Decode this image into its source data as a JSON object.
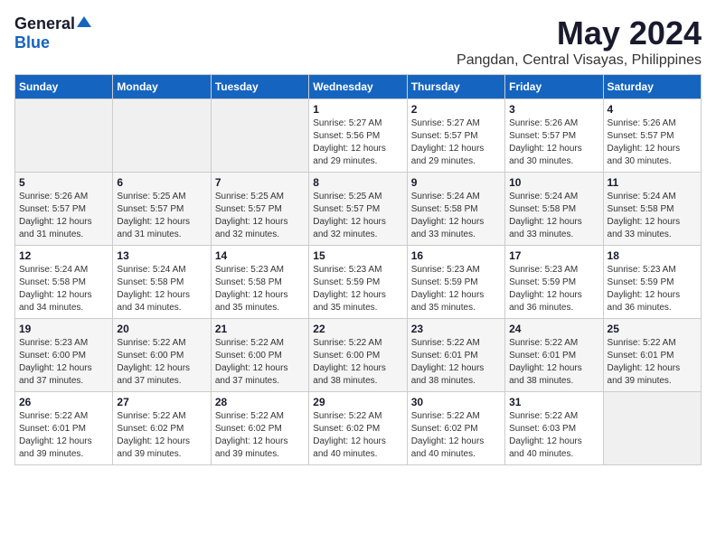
{
  "header": {
    "logo_general": "General",
    "logo_blue": "Blue",
    "month_title": "May 2024",
    "location": "Pangdan, Central Visayas, Philippines"
  },
  "days_of_week": [
    "Sunday",
    "Monday",
    "Tuesday",
    "Wednesday",
    "Thursday",
    "Friday",
    "Saturday"
  ],
  "weeks": [
    [
      {
        "day": "",
        "info": ""
      },
      {
        "day": "",
        "info": ""
      },
      {
        "day": "",
        "info": ""
      },
      {
        "day": "1",
        "info": "Sunrise: 5:27 AM\nSunset: 5:56 PM\nDaylight: 12 hours and 29 minutes."
      },
      {
        "day": "2",
        "info": "Sunrise: 5:27 AM\nSunset: 5:57 PM\nDaylight: 12 hours and 29 minutes."
      },
      {
        "day": "3",
        "info": "Sunrise: 5:26 AM\nSunset: 5:57 PM\nDaylight: 12 hours and 30 minutes."
      },
      {
        "day": "4",
        "info": "Sunrise: 5:26 AM\nSunset: 5:57 PM\nDaylight: 12 hours and 30 minutes."
      }
    ],
    [
      {
        "day": "5",
        "info": "Sunrise: 5:26 AM\nSunset: 5:57 PM\nDaylight: 12 hours and 31 minutes."
      },
      {
        "day": "6",
        "info": "Sunrise: 5:25 AM\nSunset: 5:57 PM\nDaylight: 12 hours and 31 minutes."
      },
      {
        "day": "7",
        "info": "Sunrise: 5:25 AM\nSunset: 5:57 PM\nDaylight: 12 hours and 32 minutes."
      },
      {
        "day": "8",
        "info": "Sunrise: 5:25 AM\nSunset: 5:57 PM\nDaylight: 12 hours and 32 minutes."
      },
      {
        "day": "9",
        "info": "Sunrise: 5:24 AM\nSunset: 5:58 PM\nDaylight: 12 hours and 33 minutes."
      },
      {
        "day": "10",
        "info": "Sunrise: 5:24 AM\nSunset: 5:58 PM\nDaylight: 12 hours and 33 minutes."
      },
      {
        "day": "11",
        "info": "Sunrise: 5:24 AM\nSunset: 5:58 PM\nDaylight: 12 hours and 33 minutes."
      }
    ],
    [
      {
        "day": "12",
        "info": "Sunrise: 5:24 AM\nSunset: 5:58 PM\nDaylight: 12 hours and 34 minutes."
      },
      {
        "day": "13",
        "info": "Sunrise: 5:24 AM\nSunset: 5:58 PM\nDaylight: 12 hours and 34 minutes."
      },
      {
        "day": "14",
        "info": "Sunrise: 5:23 AM\nSunset: 5:58 PM\nDaylight: 12 hours and 35 minutes."
      },
      {
        "day": "15",
        "info": "Sunrise: 5:23 AM\nSunset: 5:59 PM\nDaylight: 12 hours and 35 minutes."
      },
      {
        "day": "16",
        "info": "Sunrise: 5:23 AM\nSunset: 5:59 PM\nDaylight: 12 hours and 35 minutes."
      },
      {
        "day": "17",
        "info": "Sunrise: 5:23 AM\nSunset: 5:59 PM\nDaylight: 12 hours and 36 minutes."
      },
      {
        "day": "18",
        "info": "Sunrise: 5:23 AM\nSunset: 5:59 PM\nDaylight: 12 hours and 36 minutes."
      }
    ],
    [
      {
        "day": "19",
        "info": "Sunrise: 5:23 AM\nSunset: 6:00 PM\nDaylight: 12 hours and 37 minutes."
      },
      {
        "day": "20",
        "info": "Sunrise: 5:22 AM\nSunset: 6:00 PM\nDaylight: 12 hours and 37 minutes."
      },
      {
        "day": "21",
        "info": "Sunrise: 5:22 AM\nSunset: 6:00 PM\nDaylight: 12 hours and 37 minutes."
      },
      {
        "day": "22",
        "info": "Sunrise: 5:22 AM\nSunset: 6:00 PM\nDaylight: 12 hours and 38 minutes."
      },
      {
        "day": "23",
        "info": "Sunrise: 5:22 AM\nSunset: 6:01 PM\nDaylight: 12 hours and 38 minutes."
      },
      {
        "day": "24",
        "info": "Sunrise: 5:22 AM\nSunset: 6:01 PM\nDaylight: 12 hours and 38 minutes."
      },
      {
        "day": "25",
        "info": "Sunrise: 5:22 AM\nSunset: 6:01 PM\nDaylight: 12 hours and 39 minutes."
      }
    ],
    [
      {
        "day": "26",
        "info": "Sunrise: 5:22 AM\nSunset: 6:01 PM\nDaylight: 12 hours and 39 minutes."
      },
      {
        "day": "27",
        "info": "Sunrise: 5:22 AM\nSunset: 6:02 PM\nDaylight: 12 hours and 39 minutes."
      },
      {
        "day": "28",
        "info": "Sunrise: 5:22 AM\nSunset: 6:02 PM\nDaylight: 12 hours and 39 minutes."
      },
      {
        "day": "29",
        "info": "Sunrise: 5:22 AM\nSunset: 6:02 PM\nDaylight: 12 hours and 40 minutes."
      },
      {
        "day": "30",
        "info": "Sunrise: 5:22 AM\nSunset: 6:02 PM\nDaylight: 12 hours and 40 minutes."
      },
      {
        "day": "31",
        "info": "Sunrise: 5:22 AM\nSunset: 6:03 PM\nDaylight: 12 hours and 40 minutes."
      },
      {
        "day": "",
        "info": ""
      }
    ]
  ]
}
